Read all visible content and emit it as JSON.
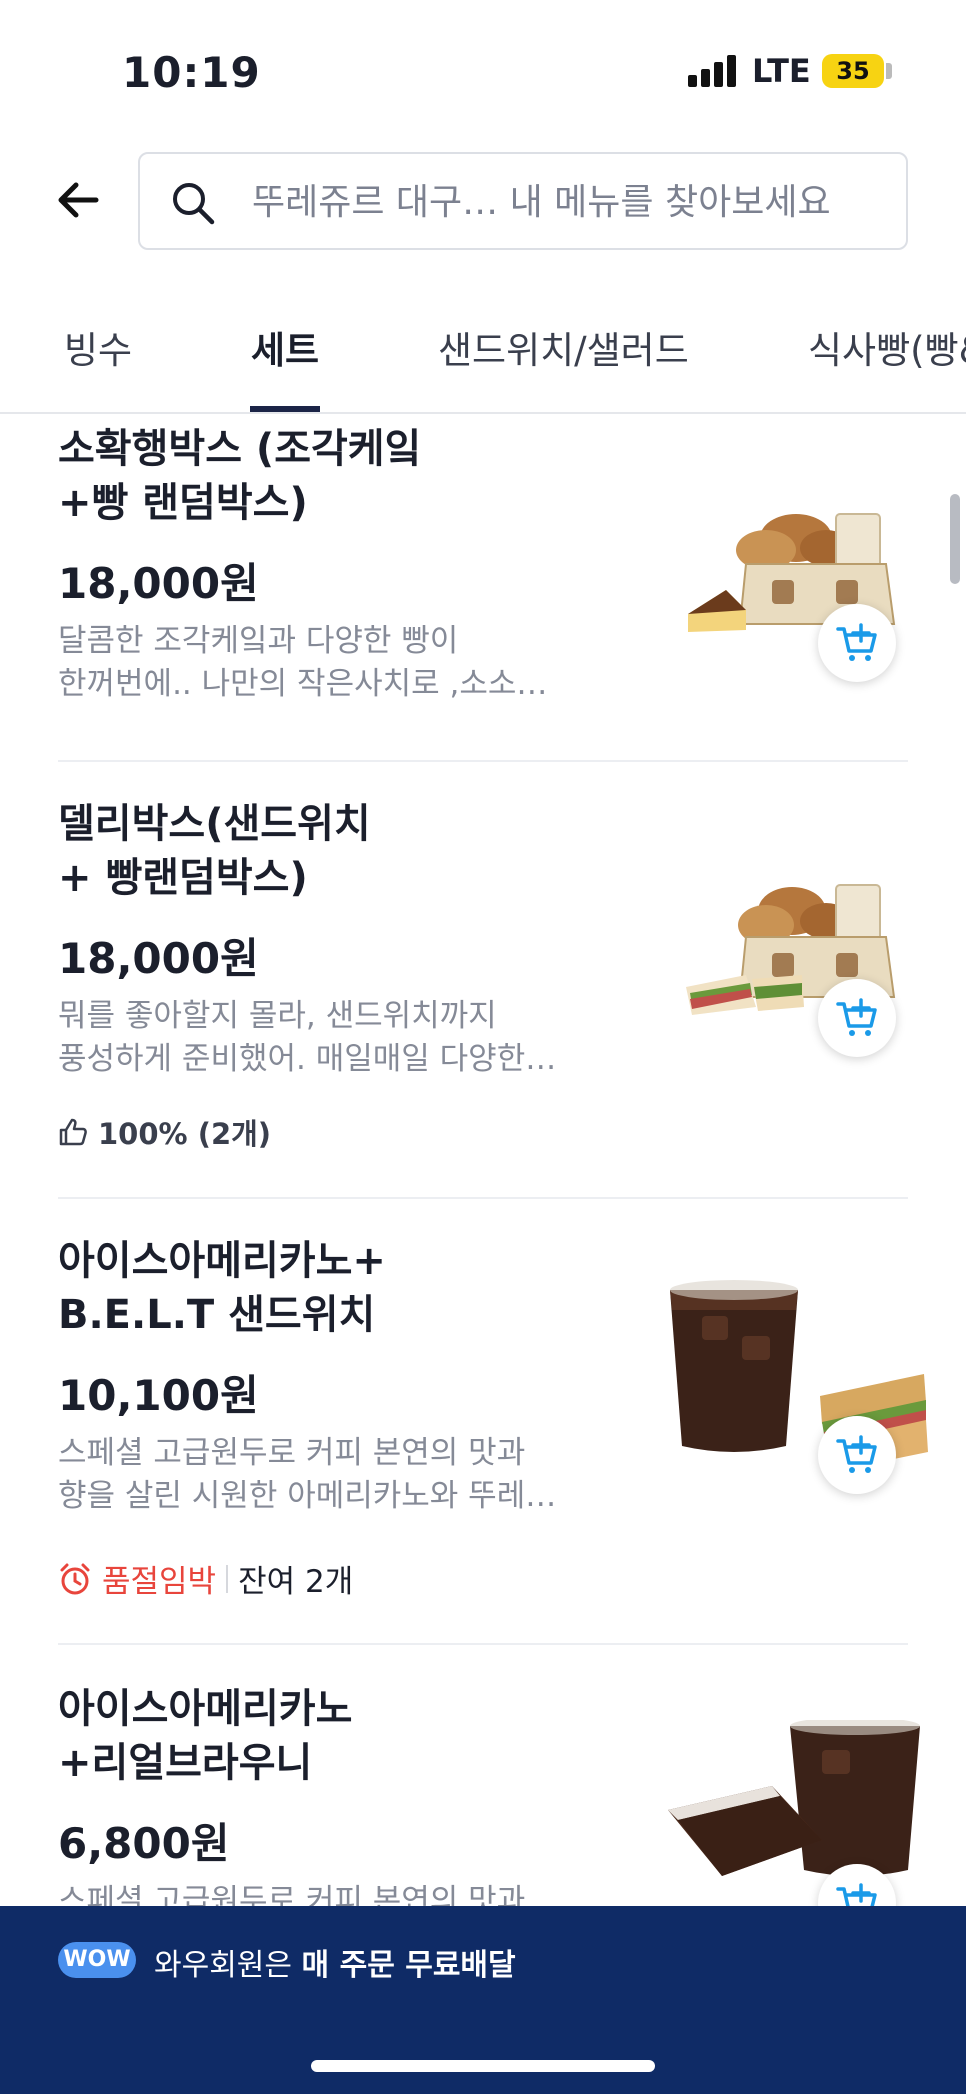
{
  "status_bar": {
    "time": "10:19",
    "network": "LTE",
    "battery": "35"
  },
  "search": {
    "placeholder": "뚜레쥬르 대구… 내 메뉴를 찾아보세요"
  },
  "tabs": [
    {
      "label": "빙수"
    },
    {
      "label": "세트"
    },
    {
      "label": "샌드위치/샐러드"
    },
    {
      "label": "식사빵(빵&"
    }
  ],
  "active_tab": "세트",
  "products": [
    {
      "name": "소확행박스 (조각케잌\n+빵 랜덤박스)",
      "price": "18,000원",
      "desc_line1": "달콤한 조각케잌과 다양한 빵이",
      "desc_line2": "한꺼번에.. 나만의 작은사치로 ,소소…"
    },
    {
      "name": "델리박스(샌드위치\n+ 빵랜덤박스)",
      "price": "18,000원",
      "desc_line1": "뭐를 좋아할지 몰라, 샌드위치까지",
      "desc_line2": "풍성하게 준비했어. 매일매일 다양한…",
      "rating": "100% (2개)"
    },
    {
      "name": "아이스아메리카노+\nB.E.L.T 샌드위치",
      "price": "10,100원",
      "desc_line1": "스페셜 고급원두로  커피 본연의 맛과",
      "desc_line2": "향을 살린 시원한 아메리카노와 뚜레…",
      "stock_warning": "품절임박",
      "stock_left": "잔여 2개"
    },
    {
      "name": "아이스아메리카노\n+리얼브라우니",
      "price": "6,800원",
      "desc_line1": "스페셜 고급원두로 커피 본연의 맛과"
    }
  ],
  "banner": {
    "badge": "WOW",
    "text_prefix": "와우회원은 ",
    "text_bold": "매 주문 무료배달"
  },
  "colors": {
    "accent_blue": "#1a9ae8",
    "warning_red": "#e8453c",
    "banner_navy": "#0f2b66"
  }
}
